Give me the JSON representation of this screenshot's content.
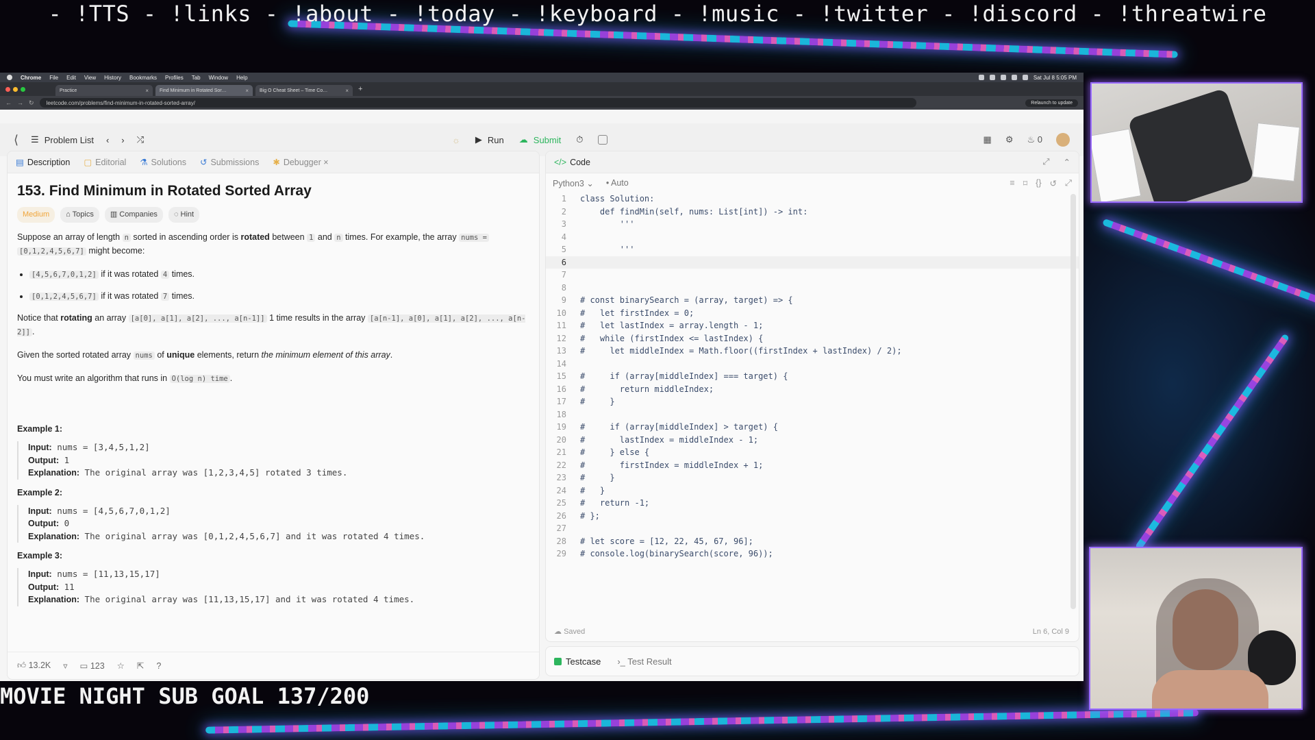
{
  "overlay": {
    "ticker": "- !TTS - !links - !about - !today - !keyboard - !music - !twitter - !discord - !threatwire",
    "sub_goal": "MOVIE NIGHT SUB GOAL 137/200"
  },
  "macos": {
    "menu": [
      "Chrome",
      "File",
      "Edit",
      "View",
      "History",
      "Bookmarks",
      "Profiles",
      "Tab",
      "Window",
      "Help"
    ],
    "clock": "Sat Jul 8 5:05 PM"
  },
  "browser": {
    "tabs": [
      "Practice",
      "Find Minimum in Rotated Sor…",
      "Big O Cheat Sheet – Time Co…"
    ],
    "url": "leetcode.com/problems/find-minimum-in-rotated-sorted-array/",
    "relaunch": "Relaunch to update"
  },
  "lc_header": {
    "problem_list": "Problem List",
    "run": "Run",
    "submit": "Submit",
    "streak": "0"
  },
  "desc_tabs": [
    "Description",
    "Editorial",
    "Solutions",
    "Submissions",
    "Debugger"
  ],
  "problem": {
    "title": "153. Find Minimum in Rotated Sorted Array",
    "difficulty": "Medium",
    "chips": [
      "Topics",
      "Companies",
      "Hint"
    ],
    "p1a": "Suppose an array of length",
    "p1_n": "n",
    "p1b": "sorted in ascending order is",
    "p1_rot": "rotated",
    "p1c": "between",
    "p1_one": "1",
    "p1d": "and",
    "p1_n2": "n",
    "p1e": "times. For example, the array",
    "p1_nums": "nums =",
    "p1_arr": "[0,1,2,4,5,6,7]",
    "p1f": "might become:",
    "bullet1_code": "[4,5,6,7,0,1,2]",
    "bullet1_text": "if it was rotated",
    "bullet1_n": "4",
    "bullet1_end": "times.",
    "bullet2_code": "[0,1,2,4,5,6,7]",
    "bullet2_text": "if it was rotated",
    "bullet2_n": "7",
    "bullet2_end": "times.",
    "p2a": "Notice that",
    "p2_rot": "rotating",
    "p2b": "an array",
    "p2_code1": "[a[0], a[1], a[2], ..., a[n-1]]",
    "p2c": "1 time results in the array",
    "p2_code2": "[a[n-1], a[0], a[1], a[2], ..., a[n-2]]",
    "p2d": ".",
    "p3a": "Given the sorted rotated array",
    "p3_nums": "nums",
    "p3b": "of",
    "p3_unique": "unique",
    "p3c": "elements, return",
    "p3_em": "the minimum element of this array",
    "p3d": ".",
    "p4a": "You must write an algorithm that runs in",
    "p4_code": "O(log n) time",
    "p4b": "."
  },
  "examples": [
    {
      "title": "Example 1:",
      "input": "nums = [3,4,5,1,2]",
      "output": "1",
      "explanation": "The original array was [1,2,3,4,5] rotated 3 times."
    },
    {
      "title": "Example 2:",
      "input": "nums = [4,5,6,7,0,1,2]",
      "output": "0",
      "explanation": "The original array was [0,1,2,4,5,6,7] and it was rotated 4 times."
    },
    {
      "title": "Example 3:",
      "input": "nums = [11,13,15,17]",
      "output": "11",
      "explanation": "The original array was [11,13,15,17] and it was rotated 4 times."
    }
  ],
  "labels": {
    "input": "Input:",
    "output": "Output:",
    "explanation": "Explanation:"
  },
  "desc_footer": {
    "likes": "13.2K",
    "comments": "123"
  },
  "code": {
    "tab": "Code",
    "language": "Python3",
    "mode": "Auto",
    "saved": "Saved",
    "cursor": "Ln 6, Col 9",
    "current_line": 6,
    "lines": [
      "class Solution:",
      "    def findMin(self, nums: List[int]) -> int:",
      "        '''",
      "",
      "        '''",
      "",
      "",
      "",
      "# const binarySearch = (array, target) => {",
      "#   let firstIndex = 0;",
      "#   let lastIndex = array.length - 1;",
      "#   while (firstIndex <= lastIndex) {",
      "#     let middleIndex = Math.floor((firstIndex + lastIndex) / 2);",
      "",
      "#     if (array[middleIndex] === target) {",
      "#       return middleIndex;",
      "#     }",
      "",
      "#     if (array[middleIndex] > target) {",
      "#       lastIndex = middleIndex - 1;",
      "#     } else {",
      "#       firstIndex = middleIndex + 1;",
      "#     }",
      "#   }",
      "#   return -1;",
      "# };",
      "",
      "# let score = [12, 22, 45, 67, 96];",
      "# console.log(binarySearch(score, 96));"
    ]
  },
  "test": {
    "testcase": "Testcase",
    "result": "Test Result"
  },
  "colors": {
    "accent_green": "#2db55d",
    "medium": "#f0a53a",
    "cam_border": "#9a6cff"
  }
}
